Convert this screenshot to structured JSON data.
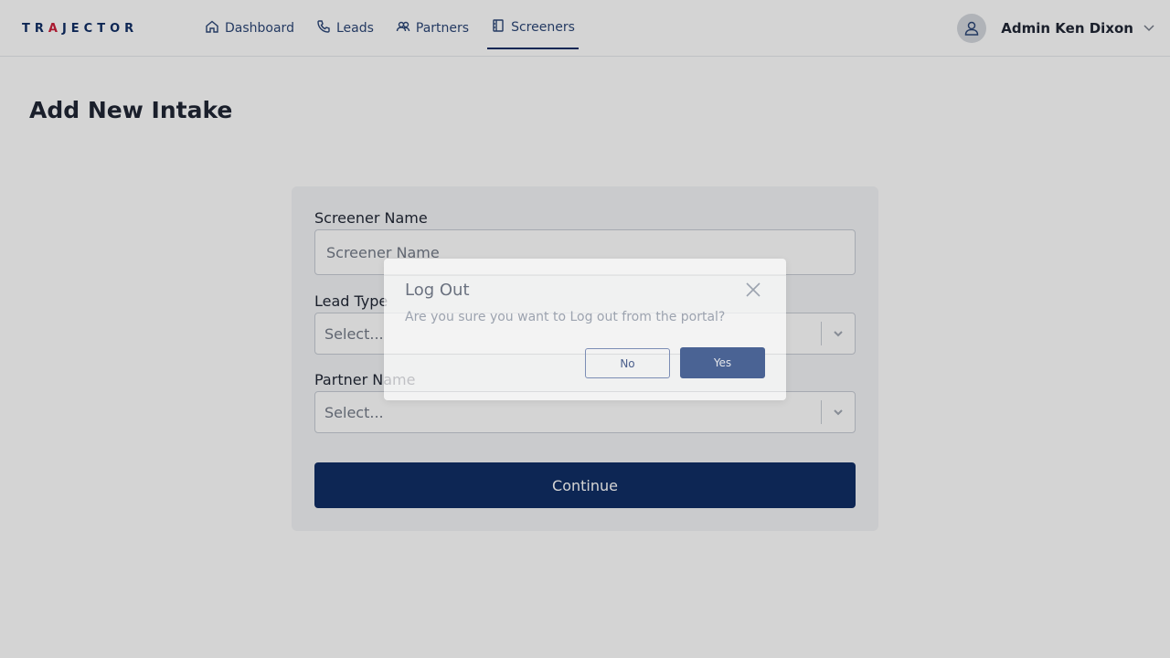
{
  "header": {
    "logo_prefix": "TR",
    "logo_accent": "A",
    "logo_suffix": "JECTOR",
    "nav": [
      {
        "label": "Dashboard",
        "icon": "home-icon"
      },
      {
        "label": "Leads",
        "icon": "phone-icon"
      },
      {
        "label": "Partners",
        "icon": "users-icon"
      },
      {
        "label": "Screeners",
        "icon": "clipboard-icon",
        "active": true
      }
    ],
    "user_name": "Admin Ken Dixon"
  },
  "page": {
    "title": "Add New Intake"
  },
  "form": {
    "screener_label": "Screener Name",
    "screener_placeholder": "Screener Name",
    "lead_type_label": "Lead Type",
    "lead_type_value": "Select...",
    "partner_label": "Partner Name",
    "partner_value": "Select...",
    "continue_label": "Continue"
  },
  "modal": {
    "title": "Log Out",
    "message": "Are you sure you want to Log out from the portal?",
    "no_label": "No",
    "yes_label": "Yes"
  },
  "colors": {
    "brand": "#00205b",
    "accent": "#c8102e",
    "modal_primary": "#4a6394"
  }
}
